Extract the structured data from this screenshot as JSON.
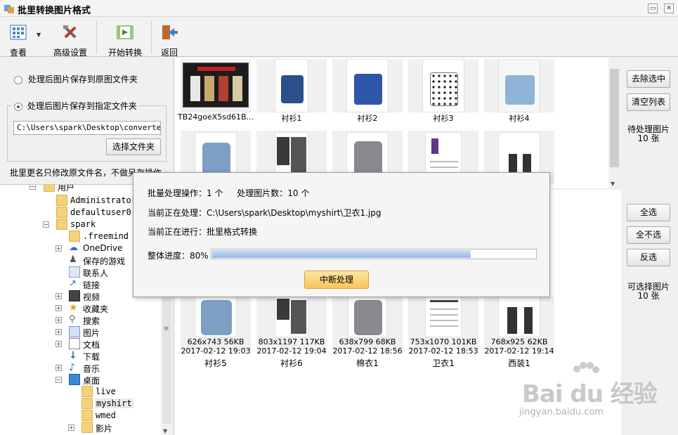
{
  "window": {
    "title": "批里转换图片格式",
    "restore_glyph": "▭",
    "close_glyph": "✕"
  },
  "toolbar": {
    "view_label": "查看",
    "advanced_label": "高级设置",
    "start_label": "开始转换",
    "back_label": "返回"
  },
  "options": {
    "save_original_label": "处理后图片保存到原图文件夹",
    "save_specified_label": "处理后图片保存到指定文件夹",
    "folder_path": "C:\\Users\\spark\\Desktop\\converted",
    "choose_folder_label": "选择文件夹",
    "rename_note": "批里更名只修改原文件名，不做另存操作"
  },
  "pending": {
    "remove_selected_label": "去除选中",
    "clear_list_label": "清空列表",
    "info_label": "待处理图片",
    "info_count": "10 张",
    "items": [
      {
        "name": "TB24goeX5sd61B..."
      },
      {
        "name": "衬衫1"
      },
      {
        "name": "衬衫2"
      },
      {
        "name": "衬衫3"
      },
      {
        "name": "衬衫4"
      }
    ]
  },
  "selectable": {
    "select_all_label": "全选",
    "select_none_label": "全不选",
    "invert_label": "反选",
    "info_label": "可选择图片",
    "info_count": "10 张",
    "items": [
      {
        "dims": "626x743  56KB",
        "date": "2017-02-12 19:03",
        "name": "衬衫5"
      },
      {
        "dims": "803x1197  117KB",
        "date": "2017-02-12 19:04",
        "name": "衬衫6"
      },
      {
        "dims": "638x799  68KB",
        "date": "2017-02-12 18:56",
        "name": "棉衣1"
      },
      {
        "dims": "753x1070  101KB",
        "date": "2017-02-12 18:53",
        "name": "卫衣1"
      },
      {
        "dims": "768x925  62KB",
        "date": "2017-02-12 19:14",
        "name": "西装1"
      }
    ]
  },
  "tree": {
    "top_partial": "用户",
    "items": [
      {
        "label": "Administrator"
      },
      {
        "label": "defaultuser0"
      },
      {
        "label": "spark"
      },
      {
        "label": ".freemind"
      },
      {
        "label": "OneDrive"
      },
      {
        "label": "保存的游戏"
      },
      {
        "label": "联系人"
      },
      {
        "label": "链接"
      },
      {
        "label": "视频"
      },
      {
        "label": "收藏夹"
      },
      {
        "label": "搜索"
      },
      {
        "label": "图片"
      },
      {
        "label": "文档"
      },
      {
        "label": "下载"
      },
      {
        "label": "音乐"
      },
      {
        "label": "桌面"
      },
      {
        "label": "live"
      },
      {
        "label": "myshirt"
      },
      {
        "label": "wmed"
      },
      {
        "label": "影片"
      }
    ]
  },
  "dialog": {
    "ops_label": "批量处理操作：1 个",
    "count_label": "处理图片数：10 个",
    "current_file_label": "当前正在处理：C:\\Users\\spark\\Desktop\\myshirt\\卫衣1.jpg",
    "current_op_label": "当前正在进行：批里格式转换",
    "progress_label": "整体进度：80%",
    "progress": 0.8,
    "abort_label": "中断处理"
  },
  "watermark": {
    "main": "Bai du 经验",
    "sub": "jingyan.baidu.com"
  },
  "colors": {
    "accent": "#f7c65c",
    "progress": "#93b6e8",
    "window": "#f0f0f0"
  }
}
